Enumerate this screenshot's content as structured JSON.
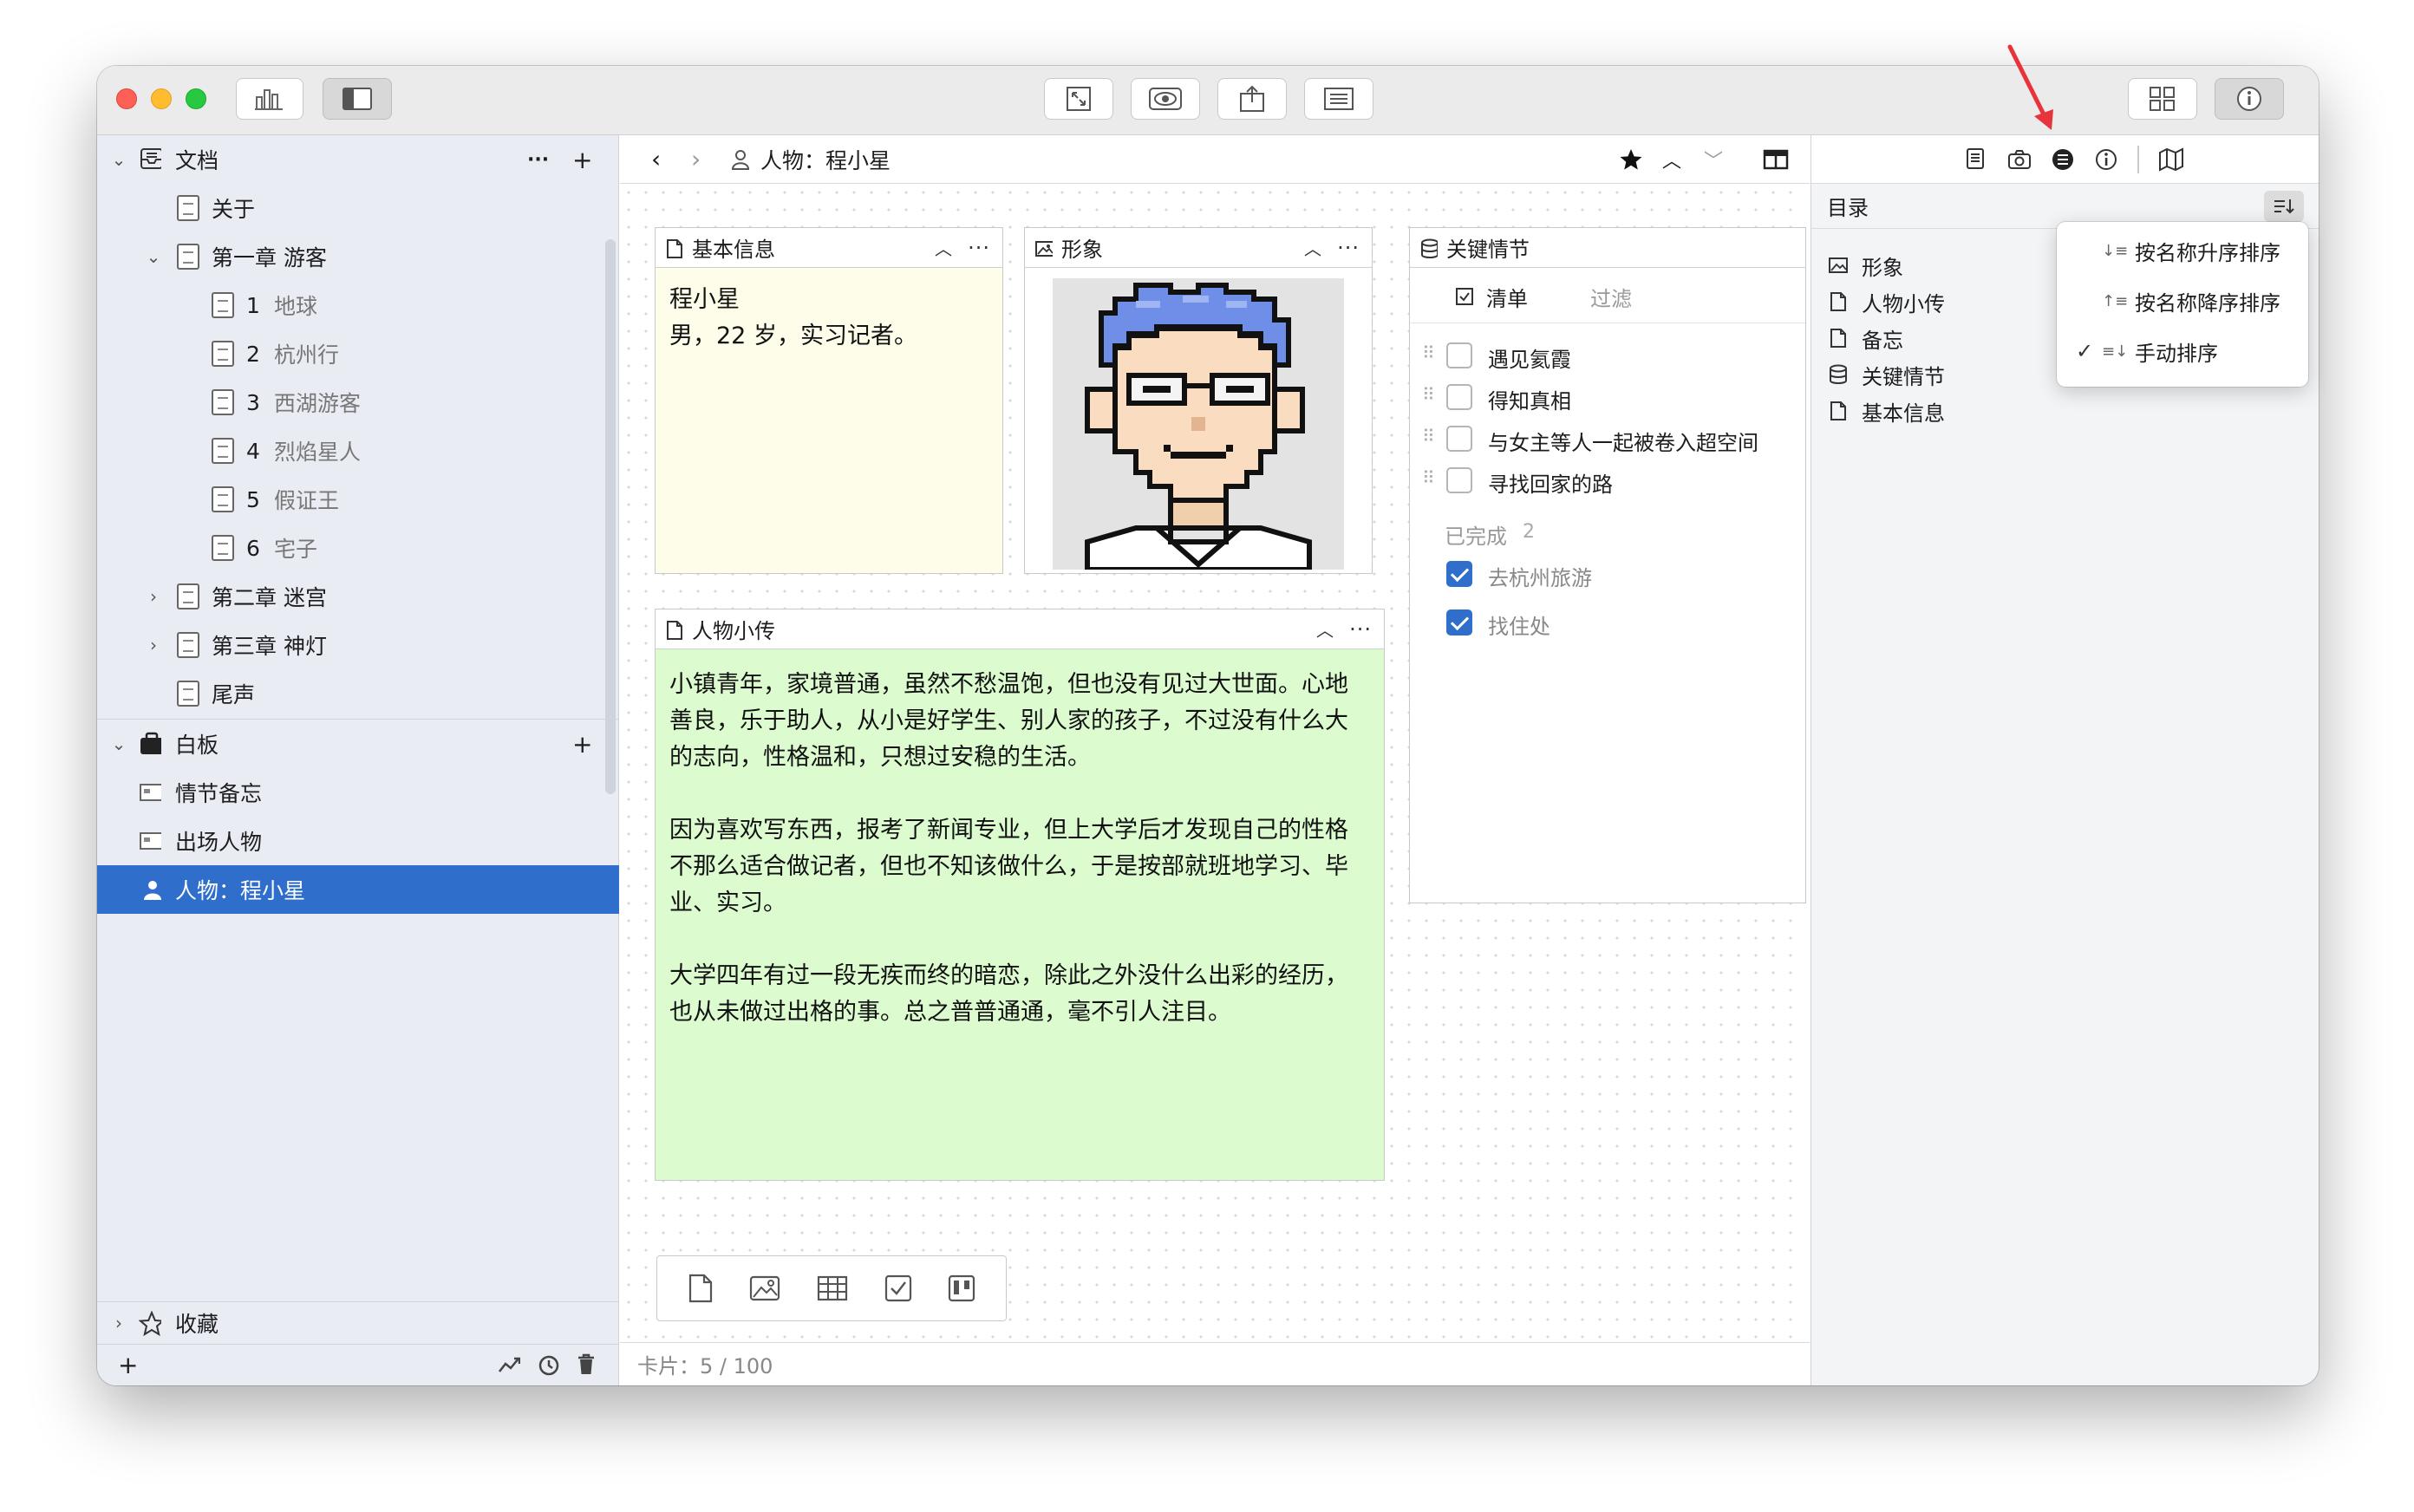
{
  "sidebar": {
    "docs_header": "文档",
    "docs_items": [
      {
        "num": "",
        "label": "关于"
      },
      {
        "num": "",
        "label": "第一章 游客"
      },
      {
        "num": "1",
        "label": "地球"
      },
      {
        "num": "2",
        "label": "杭州行"
      },
      {
        "num": "3",
        "label": "西湖游客"
      },
      {
        "num": "4",
        "label": "烈焰星人"
      },
      {
        "num": "5",
        "label": "假证王"
      },
      {
        "num": "6",
        "label": "宅子"
      },
      {
        "num": "",
        "label": "第二章 迷宫"
      },
      {
        "num": "",
        "label": "第三章 神灯"
      },
      {
        "num": "",
        "label": "尾声"
      }
    ],
    "boards_header": "白板",
    "board_items": [
      "情节备忘",
      "出场人物",
      "人物：程小星"
    ],
    "favorites": "收藏",
    "more": "···",
    "plus": "+"
  },
  "main": {
    "breadcrumb": "人物：程小星",
    "status": "卡片：5 / 100",
    "cards": {
      "basic": {
        "title": "基本信息",
        "line1": "程小星",
        "line2": "男，22 岁，实习记者。"
      },
      "image": {
        "title": "形象"
      },
      "plot": {
        "title": "关键情节",
        "tab_list": "清单",
        "tab_filter": "过滤",
        "todo": [
          "遇见氦霞",
          "得知真相",
          "与女主等人一起被卷入超空间",
          "寻找回家的路"
        ],
        "done_label": "已完成",
        "done_count": "2",
        "done": [
          "去杭州旅游",
          "找住处"
        ]
      },
      "bio": {
        "title": "人物小传",
        "p1": "小镇青年，家境普通，虽然不愁温饱，但也没有见过大世面。心地善良，乐于助人，从小是好学生、别人家的孩子，不过没有什么大的志向，性格温和，只想过安稳的生活。",
        "p2": "因为喜欢写东西，报考了新闻专业，但上大学后才发现自己的性格不那么适合做记者，但也不知该做什么，于是按部就班地学习、毕业、实习。",
        "p3": "大学四年有过一段无疾而终的暗恋，除此之外没什么出彩的经历，也从未做过出格的事。总之普普通通，毫不引人注目。"
      }
    }
  },
  "inspector": {
    "toc_title": "目录",
    "toc_items": [
      "形象",
      "人物小传",
      "备忘",
      "关键情节",
      "基本信息"
    ],
    "sort_menu": [
      "按名称升序排序",
      "按名称降序排序",
      "手动排序"
    ],
    "checked": "✓"
  },
  "colors": {
    "accent": "#2f6fcb",
    "basic_card_bg": "#fdfdea",
    "bio_card_bg": "#dcfcd0",
    "annotation_arrow": "#e8323c"
  }
}
